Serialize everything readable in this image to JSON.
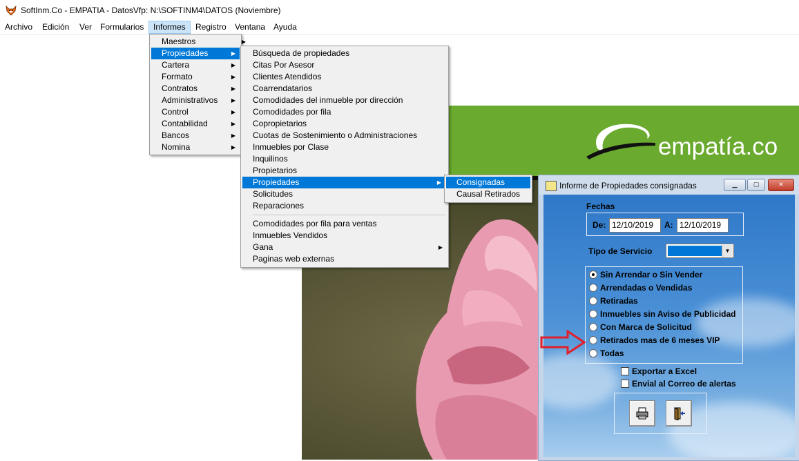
{
  "window": {
    "title": "SoftInm.Co - EMPATIA - DatosVfp: N:\\SOFTINM4\\DATOS  (Noviembre)"
  },
  "menubar": [
    "Archivo",
    "Edición",
    "Ver",
    "Formularios",
    "Informes",
    "Registro",
    "Ventana",
    "Ayuda"
  ],
  "informes_menu": [
    "Maestros",
    "Propiedades",
    "Cartera",
    "Formato",
    "Contratos",
    "Administrativos",
    "Control",
    "Contabilidad",
    "Bancos",
    "Nomina"
  ],
  "propiedades_menu": {
    "group1": [
      "Búsqueda de propiedades",
      "Citas Por Asesor",
      "Clientes Atendidos",
      "Coarrendatarios",
      "Comodidades del inmueble por dirección",
      "Comodidades por fila",
      "Copropietarios",
      "Cuotas de Sostenimiento o Administraciones",
      "Inmuebles por Clase",
      "Inquilinos",
      "Propietarios",
      "Propiedades",
      "Solicitudes",
      "Reparaciones"
    ],
    "group2": [
      "Comodidades por fila para ventas",
      "Inmuebles Vendidos",
      "Gana",
      "Paginas web externas"
    ]
  },
  "propiedades_submenu": [
    "Consignadas",
    "Causal Retirados"
  ],
  "background": {
    "logo_text": "empatía.co",
    "banner_char": "t"
  },
  "dialog": {
    "title": "Informe de Propiedades consignadas",
    "fechas_label": "Fechas",
    "de_label": "De:",
    "de_value": "12/10/2019",
    "a_label": "A:",
    "a_value": "12/10/2019",
    "tipo_servicio_label": "Tipo de Servicio",
    "tipo_servicio_value": "",
    "options": [
      "Sin Arrendar o Sin Vender",
      "Arrendadas o Vendidas",
      "Retiradas",
      "Inmuebles sin Aviso de Publicidad",
      "Con Marca de Solicitud",
      "Retirados mas de 6 meses VIP",
      "Todas"
    ],
    "selected_option": "Sin Arrendar o Sin Vender",
    "checkboxes": [
      "Exportar a Excel",
      "Envial al Correo de alertas"
    ]
  },
  "colors": {
    "highlight": "#0078d7",
    "menu_bg": "#f0f0f0",
    "banner_green": "#6aaa2e",
    "dialog_blue": "#2f78c8",
    "arrow_red": "#e0202a"
  }
}
